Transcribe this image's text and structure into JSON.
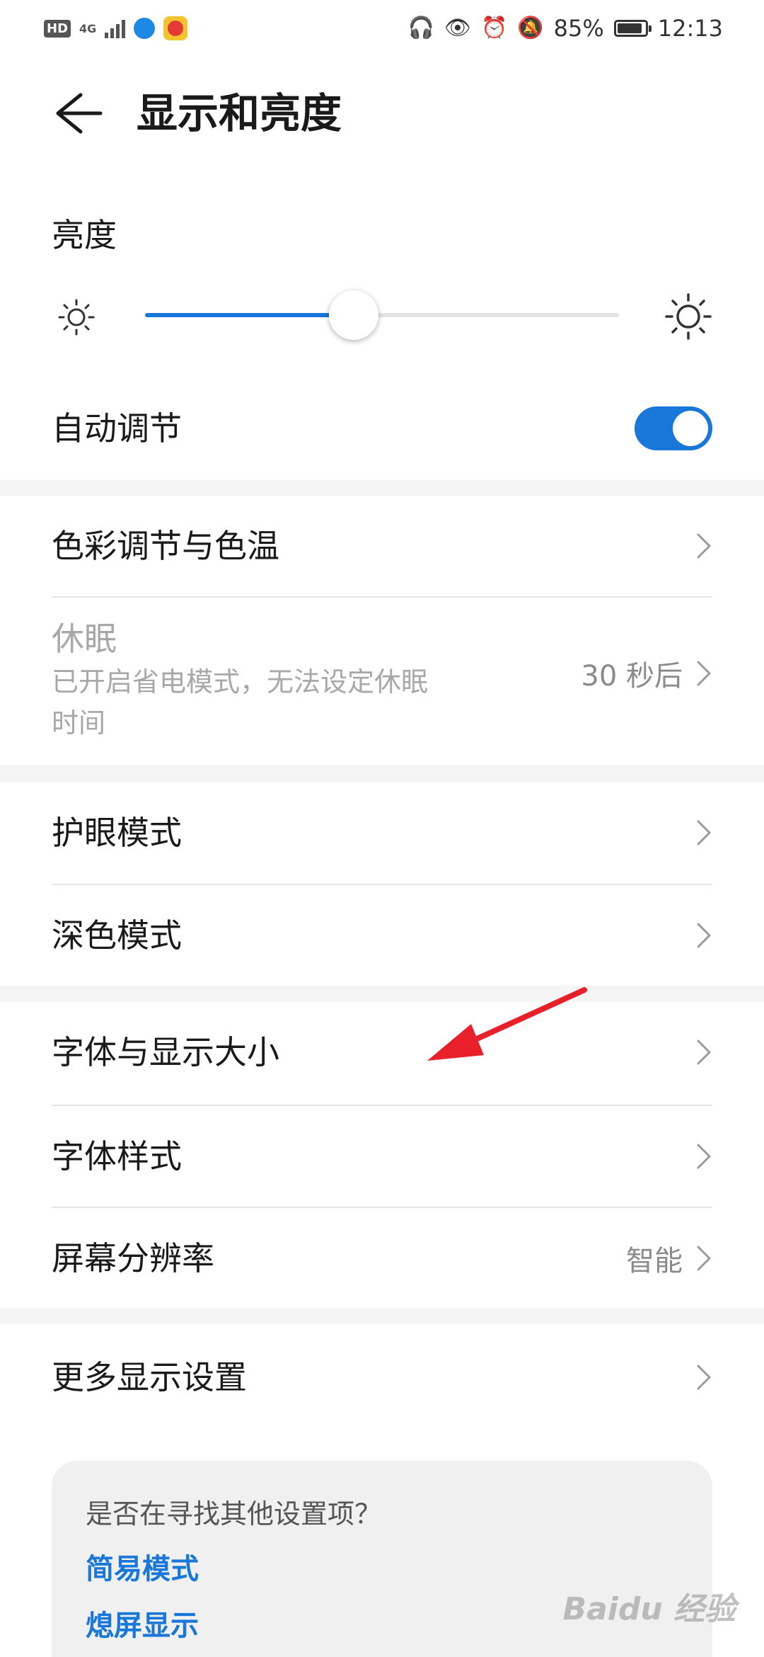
{
  "status_bar": {
    "hd": "HD",
    "network": "4G",
    "battery_percent": "85%",
    "time": "12:13"
  },
  "header": {
    "title": "显示和亮度"
  },
  "brightness": {
    "label": "亮度",
    "level_fraction": 0.44
  },
  "auto_adjust": {
    "label": "自动调节",
    "on": true
  },
  "items": {
    "color": {
      "label": "色彩调节与色温"
    },
    "sleep": {
      "label": "休眠",
      "subtitle": "已开启省电模式，无法设定休眠",
      "subtitle2": "时间",
      "value": "30 秒后"
    },
    "eye": {
      "label": "护眼模式"
    },
    "dark": {
      "label": "深色模式"
    },
    "font_size": {
      "label": "字体与显示大小"
    },
    "font_style": {
      "label": "字体样式"
    },
    "resolution": {
      "label": "屏幕分辨率",
      "value": "智能"
    },
    "more": {
      "label": "更多显示设置"
    }
  },
  "suggest_card": {
    "question": "是否在寻找其他设置项？",
    "links": [
      "简易模式",
      "熄屏显示"
    ]
  },
  "watermark": "Baidu 经验",
  "colors": {
    "accent": "#1877d8",
    "arrow": "#e8202a"
  }
}
